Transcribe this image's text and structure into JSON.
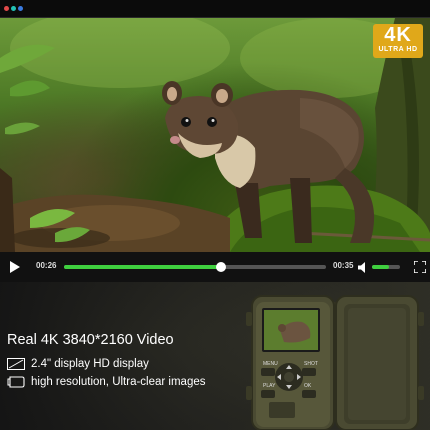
{
  "player": {
    "current_time": "00:26",
    "duration": "00:35",
    "progress": 0.6,
    "volume": 0.6
  },
  "badge": {
    "big": "4K",
    "small": "ULTRA HD"
  },
  "product": {
    "headline": "Real 4K 3840*2160 Video",
    "features": [
      {
        "icon": "display-icon",
        "text": "2.4\" display HD display"
      },
      {
        "icon": "camera-icon",
        "text": "high resolution, Ultra-clear images"
      }
    ],
    "camera_buttons": [
      "MENU",
      "SHOT",
      "PLAY",
      "OK"
    ]
  },
  "colors": {
    "accent": "#3fcf3f",
    "badge": "#e0a81a",
    "camera_body": "#4a4a32"
  }
}
